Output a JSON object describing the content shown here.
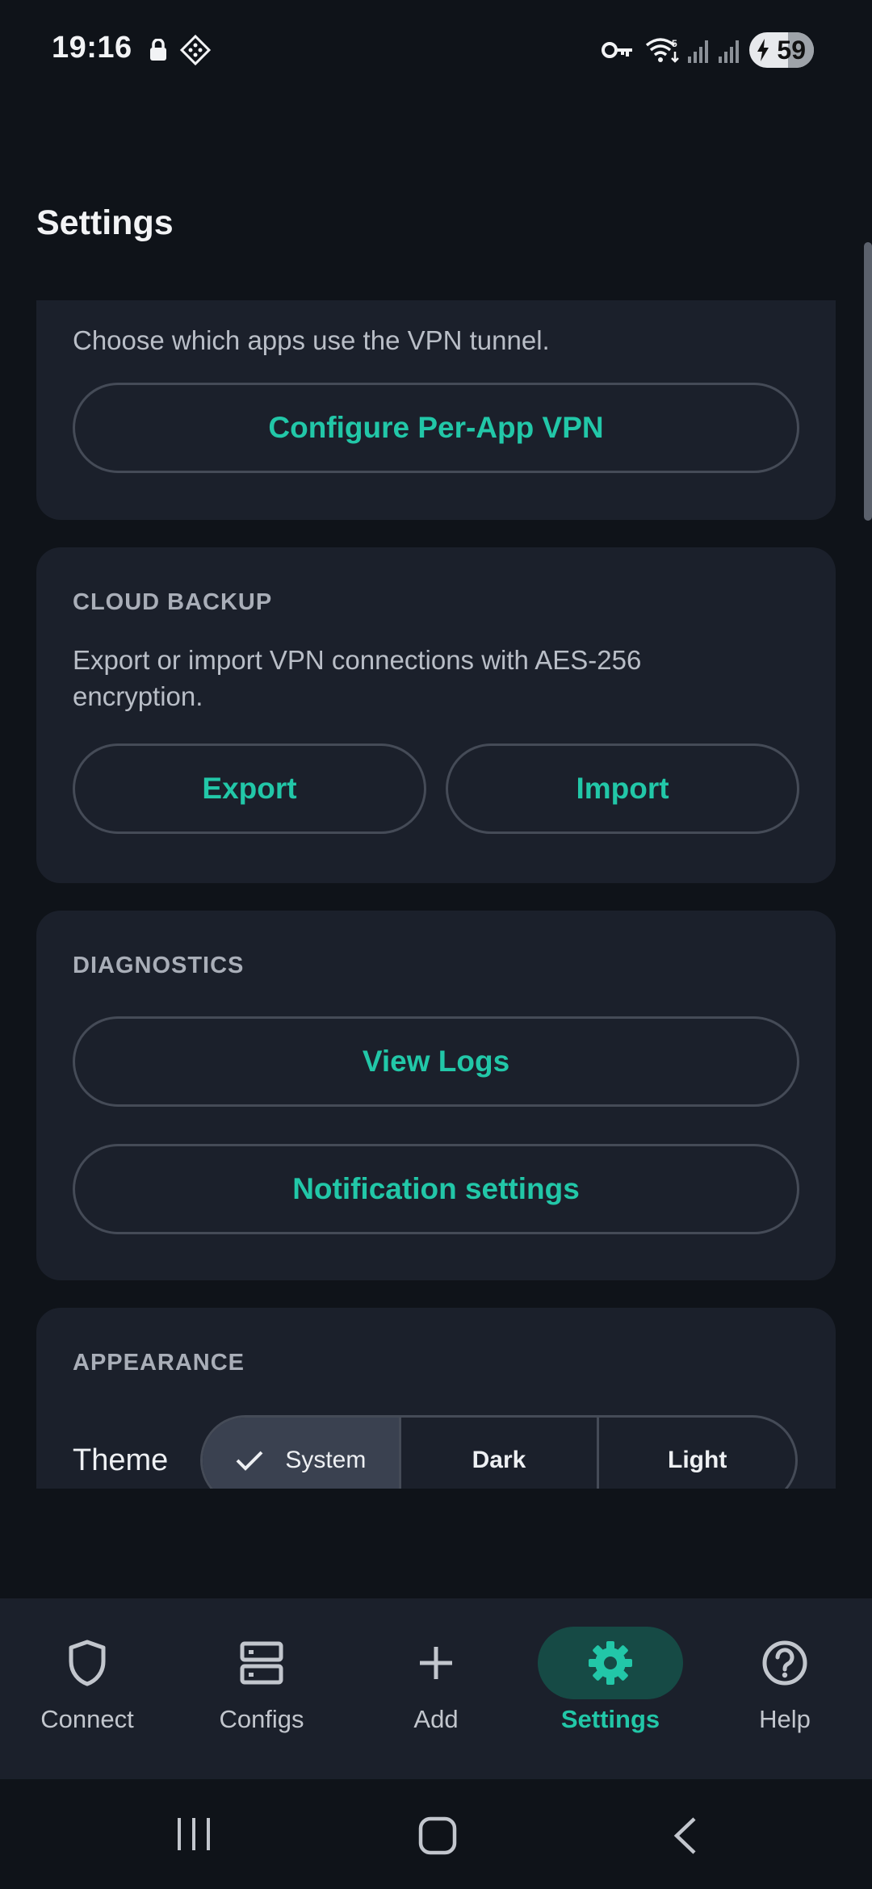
{
  "status_bar": {
    "time": "19:16",
    "battery": "59",
    "icons": [
      "lock-icon",
      "app-badge-icon",
      "vpn-key-icon",
      "wifi-icon",
      "signal-icon",
      "signal-icon",
      "battery-charging-icon"
    ]
  },
  "header": {
    "title": "Settings"
  },
  "sections": {
    "per_app": {
      "description": "Choose which apps use the VPN tunnel.",
      "button": "Configure Per-App VPN"
    },
    "cloud_backup": {
      "label": "CLOUD BACKUP",
      "description": "Export or import VPN connections with AES-256 encryption.",
      "export_button": "Export",
      "import_button": "Import"
    },
    "diagnostics": {
      "label": "DIAGNOSTICS",
      "view_logs_button": "View Logs",
      "notification_button": "Notification settings"
    },
    "appearance": {
      "label": "APPEARANCE",
      "theme_label": "Theme",
      "theme_options": [
        "System",
        "Dark",
        "Light"
      ],
      "theme_selected": "System"
    }
  },
  "bottom_nav": {
    "items": [
      {
        "label": "Connect",
        "icon": "shield-icon"
      },
      {
        "label": "Configs",
        "icon": "server-icon"
      },
      {
        "label": "Add",
        "icon": "plus-icon"
      },
      {
        "label": "Settings",
        "icon": "gear-icon"
      },
      {
        "label": "Help",
        "icon": "help-icon"
      }
    ],
    "active": "Settings"
  },
  "colors": {
    "accent": "#22c7a8",
    "background": "#0f1319",
    "card": "#1b202b",
    "active_pill": "#164a45"
  }
}
